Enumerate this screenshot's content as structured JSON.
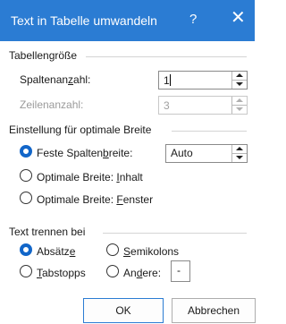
{
  "window": {
    "title": "Text in Tabelle umwandeln",
    "help": "?",
    "close": "✕"
  },
  "table_size": {
    "label": "Tabellengröße",
    "columns": {
      "label_pre": "Spaltenan",
      "label_u": "z",
      "label_post": "ahl:",
      "value": "1"
    },
    "rows": {
      "label": "Zeilenanzahl:",
      "value": "3"
    }
  },
  "autofit": {
    "label": "Einstellung für optimale Breite",
    "fixed": {
      "label_pre": "Feste Spalten",
      "label_u": "b",
      "label_post": "reite:",
      "value": "Auto",
      "checked": true
    },
    "contents": {
      "label_pre": "Optimale Breite: ",
      "label_u": "I",
      "label_post": "nhalt",
      "checked": false
    },
    "window": {
      "label_pre": "Optimale Breite: ",
      "label_u": "F",
      "label_post": "enster",
      "checked": false
    }
  },
  "separate": {
    "label": "Text trennen bei",
    "paragraphs": {
      "label_pre": "Absätz",
      "label_u": "e",
      "label_post": "",
      "checked": true
    },
    "semicolons": {
      "label_pre": "",
      "label_u": "S",
      "label_post": "emikolons",
      "checked": false
    },
    "tabs": {
      "label_pre": "",
      "label_u": "T",
      "label_post": "abstopps",
      "checked": false
    },
    "other": {
      "label_pre": "An",
      "label_u": "d",
      "label_post": "ere:",
      "value": "-",
      "checked": false
    }
  },
  "buttons": {
    "ok": "OK",
    "cancel": "Abbrechen"
  },
  "colors": {
    "titlebar": "#2b7cd3",
    "radio_checked": "#1266c9"
  }
}
